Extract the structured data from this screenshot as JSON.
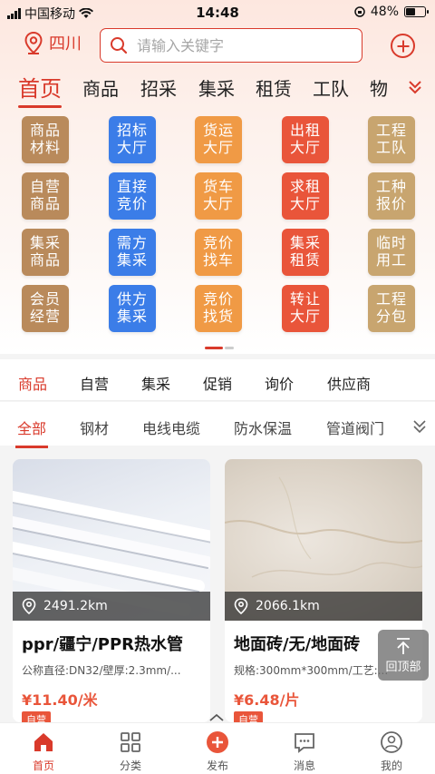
{
  "status": {
    "carrier": "中国移动",
    "time": "14:48",
    "battery": "48%",
    "battery_level": 0.48
  },
  "header": {
    "location": "四川",
    "search_placeholder": "请输入关键字"
  },
  "main_tabs": [
    {
      "label": "首页"
    },
    {
      "label": "商品"
    },
    {
      "label": "招采"
    },
    {
      "label": "集采"
    },
    {
      "label": "租赁"
    },
    {
      "label": "工队"
    },
    {
      "label": "物"
    }
  ],
  "grid": [
    {
      "label": "商品材料",
      "color": "#b98a5b"
    },
    {
      "label": "招标大厅",
      "color": "#3b7de8"
    },
    {
      "label": "货运大厅",
      "color": "#f09a45"
    },
    {
      "label": "出租大厅",
      "color": "#e9553a"
    },
    {
      "label": "工程工队",
      "color": "#c8a56f"
    },
    {
      "label": "自营商品",
      "color": "#b98a5b"
    },
    {
      "label": "直接竞价",
      "color": "#3b7de8"
    },
    {
      "label": "货车大厅",
      "color": "#f09a45"
    },
    {
      "label": "求租大厅",
      "color": "#e9553a"
    },
    {
      "label": "工种报价",
      "color": "#c8a56f"
    },
    {
      "label": "集采商品",
      "color": "#b98a5b"
    },
    {
      "label": "需方集采",
      "color": "#3b7de8"
    },
    {
      "label": "竞价找车",
      "color": "#f09a45"
    },
    {
      "label": "集采租赁",
      "color": "#e9553a"
    },
    {
      "label": "临时用工",
      "color": "#c8a56f"
    },
    {
      "label": "会员经营",
      "color": "#b98a5b"
    },
    {
      "label": "供方集采",
      "color": "#3b7de8"
    },
    {
      "label": "竞价找货",
      "color": "#f09a45"
    },
    {
      "label": "转让大厅",
      "color": "#e9553a"
    },
    {
      "label": "工程分包",
      "color": "#c8a56f"
    }
  ],
  "category_tabs": [
    {
      "label": "商品"
    },
    {
      "label": "自营"
    },
    {
      "label": "集采"
    },
    {
      "label": "促销"
    },
    {
      "label": "询价"
    },
    {
      "label": "供应商"
    }
  ],
  "sub_tabs": [
    {
      "label": "全部"
    },
    {
      "label": "钢材"
    },
    {
      "label": "电线电缆"
    },
    {
      "label": "防水保温"
    },
    {
      "label": "管道阀门"
    }
  ],
  "products": [
    {
      "distance": "2491.2km",
      "title": "ppr/疆宁/PPR热水管",
      "spec": "公称直径:DN32/壁厚:2.3mm/...",
      "price": "¥11.40/米",
      "badge": "自营"
    },
    {
      "distance": "2066.1km",
      "title": "地面砖/无/地面砖",
      "spec": "规格:300mm*300mm/工艺:...",
      "price": "¥6.48/片",
      "badge": "自营"
    }
  ],
  "back_top_label": "回顶部",
  "bottom_nav": [
    {
      "label": "首页"
    },
    {
      "label": "分类"
    },
    {
      "label": "发布"
    },
    {
      "label": "消息"
    },
    {
      "label": "我的"
    }
  ],
  "accent": "#d93a2b"
}
